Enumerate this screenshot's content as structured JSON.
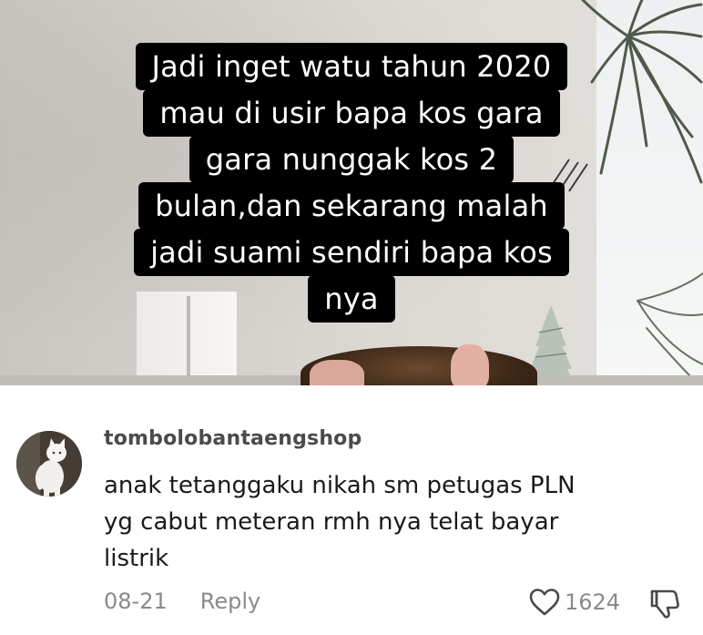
{
  "video": {
    "caption_lines": [
      "Jadi inget watu tahun 2020",
      "mau di usir bapa kos gara",
      "gara nunggak kos 2",
      "bulan,dan sekarang malah",
      "jadi suami sendiri bapa kos",
      "nya"
    ]
  },
  "comment": {
    "username": "tombolobantaengshop",
    "text_lines": [
      "anak tetanggaku nikah sm petugas PLN",
      "yg cabut meteran rmh nya telat bayar",
      "listrik"
    ],
    "date": "08-21",
    "reply_label": "Reply",
    "like_count": "1624",
    "like_icon": "heart-outline-icon",
    "dislike_icon": "thumbs-down-outline-icon"
  }
}
